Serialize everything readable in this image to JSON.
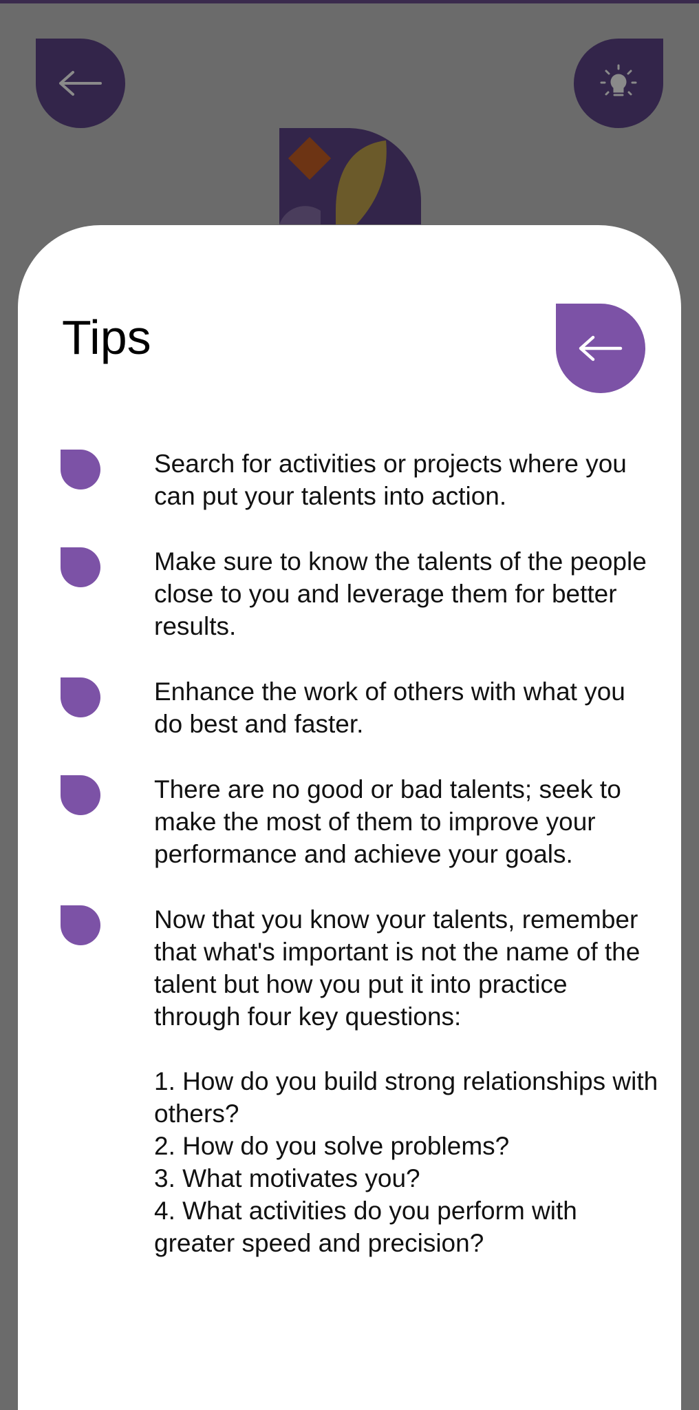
{
  "background": {
    "back_icon": "arrow-left-icon",
    "tip_icon": "lightbulb-icon"
  },
  "sheet": {
    "title": "Tips",
    "close_icon": "arrow-left-icon"
  },
  "tips": [
    "Search for activities or projects where you can put your talents into action.",
    "Make sure to know the talents of the people close to you and leverage them for better results.",
    "Enhance the work of others with what you do best and faster.",
    "There are no good or bad talents; seek to make the most of them to improve your performance and achieve your goals.",
    "Now that you know your talents, remember that what's important is not the name of the talent but how you put it into practice through four key questions:\n\n1. How do you build strong relationships with others?\n2. How do you solve problems?\n3. What motivates you?\n4. What activities do you perform with greater speed and precision?"
  ],
  "colors": {
    "accent": "#7c52a6",
    "overlay": "#6b6b6b",
    "dark_button": "#33254a"
  }
}
